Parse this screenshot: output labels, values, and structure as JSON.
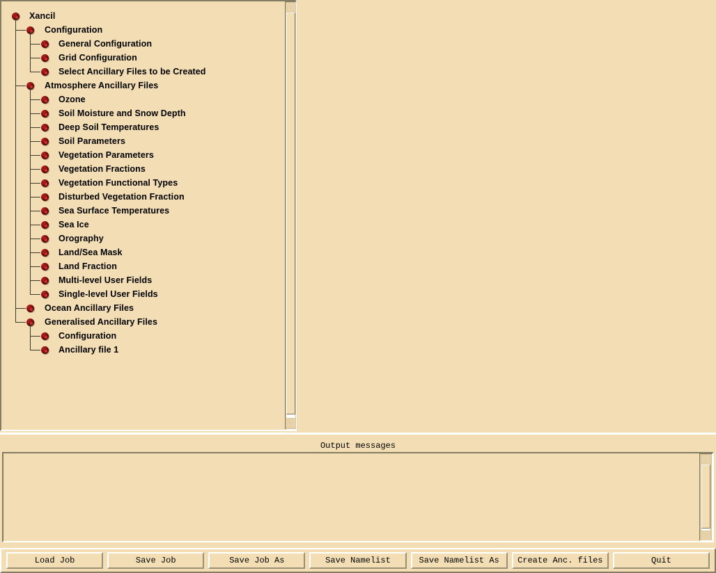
{
  "app": {
    "title": "Xancil",
    "background_color": "#f2ddb4",
    "node_color": "#8f1414",
    "line_color": "#3a3a2c",
    "shadow_color": "#837b62",
    "highlight_color": "#ffffff"
  },
  "tree": {
    "nodes": [
      {
        "label": "Xancil",
        "depth": 0,
        "icon": "node-bullet-icon"
      },
      {
        "label": "Configuration",
        "depth": 1,
        "icon": "node-bullet-icon"
      },
      {
        "label": "General Configuration",
        "depth": 2,
        "icon": "node-bullet-icon"
      },
      {
        "label": "Grid Configuration",
        "depth": 2,
        "icon": "node-bullet-icon"
      },
      {
        "label": "Select Ancillary Files to be Created",
        "depth": 2,
        "icon": "node-bullet-icon"
      },
      {
        "label": "Atmosphere Ancillary Files",
        "depth": 1,
        "icon": "node-bullet-icon"
      },
      {
        "label": "Ozone",
        "depth": 2,
        "icon": "node-bullet-icon"
      },
      {
        "label": "Soil Moisture and Snow Depth",
        "depth": 2,
        "icon": "node-bullet-icon"
      },
      {
        "label": "Deep Soil Temperatures",
        "depth": 2,
        "icon": "node-bullet-icon"
      },
      {
        "label": "Soil Parameters",
        "depth": 2,
        "icon": "node-bullet-icon"
      },
      {
        "label": "Vegetation Parameters",
        "depth": 2,
        "icon": "node-bullet-icon"
      },
      {
        "label": "Vegetation Fractions",
        "depth": 2,
        "icon": "node-bullet-icon"
      },
      {
        "label": "Vegetation Functional Types",
        "depth": 2,
        "icon": "node-bullet-icon"
      },
      {
        "label": "Disturbed Vegetation Fraction",
        "depth": 2,
        "icon": "node-bullet-icon"
      },
      {
        "label": "Sea Surface Temperatures",
        "depth": 2,
        "icon": "node-bullet-icon"
      },
      {
        "label": "Sea Ice",
        "depth": 2,
        "icon": "node-bullet-icon"
      },
      {
        "label": "Orography",
        "depth": 2,
        "icon": "node-bullet-icon"
      },
      {
        "label": "Land/Sea Mask",
        "depth": 2,
        "icon": "node-bullet-icon"
      },
      {
        "label": "Land Fraction",
        "depth": 2,
        "icon": "node-bullet-icon"
      },
      {
        "label": "Multi-level User Fields",
        "depth": 2,
        "icon": "node-bullet-icon"
      },
      {
        "label": "Single-level User Fields",
        "depth": 2,
        "icon": "node-bullet-icon"
      },
      {
        "label": "Ocean Ancillary Files",
        "depth": 1,
        "icon": "node-bullet-icon"
      },
      {
        "label": "Generalised Ancillary Files",
        "depth": 1,
        "icon": "node-bullet-icon"
      },
      {
        "label": "Configuration",
        "depth": 2,
        "icon": "node-bullet-icon"
      },
      {
        "label": "Ancillary file 1",
        "depth": 2,
        "icon": "node-bullet-icon"
      }
    ]
  },
  "tree_scrollbar": {
    "up_arrow_icon": "triangle-up-icon",
    "down_arrow_icon": "triangle-down-icon"
  },
  "output": {
    "label": "Output messages",
    "text": "",
    "scrollbar": {
      "up_arrow_icon": "triangle-up-icon",
      "down_arrow_icon": "triangle-down-icon"
    }
  },
  "buttons": [
    {
      "label": "Load Job",
      "width": 142
    },
    {
      "label": "Save Job",
      "width": 142
    },
    {
      "label": "Save Job As",
      "width": 142
    },
    {
      "label": "Save Namelist",
      "width": 142
    },
    {
      "label": "Save Namelist As",
      "width": 142
    },
    {
      "label": "Create Anc. files",
      "width": 142
    },
    {
      "label": "Quit",
      "width": 142
    }
  ]
}
